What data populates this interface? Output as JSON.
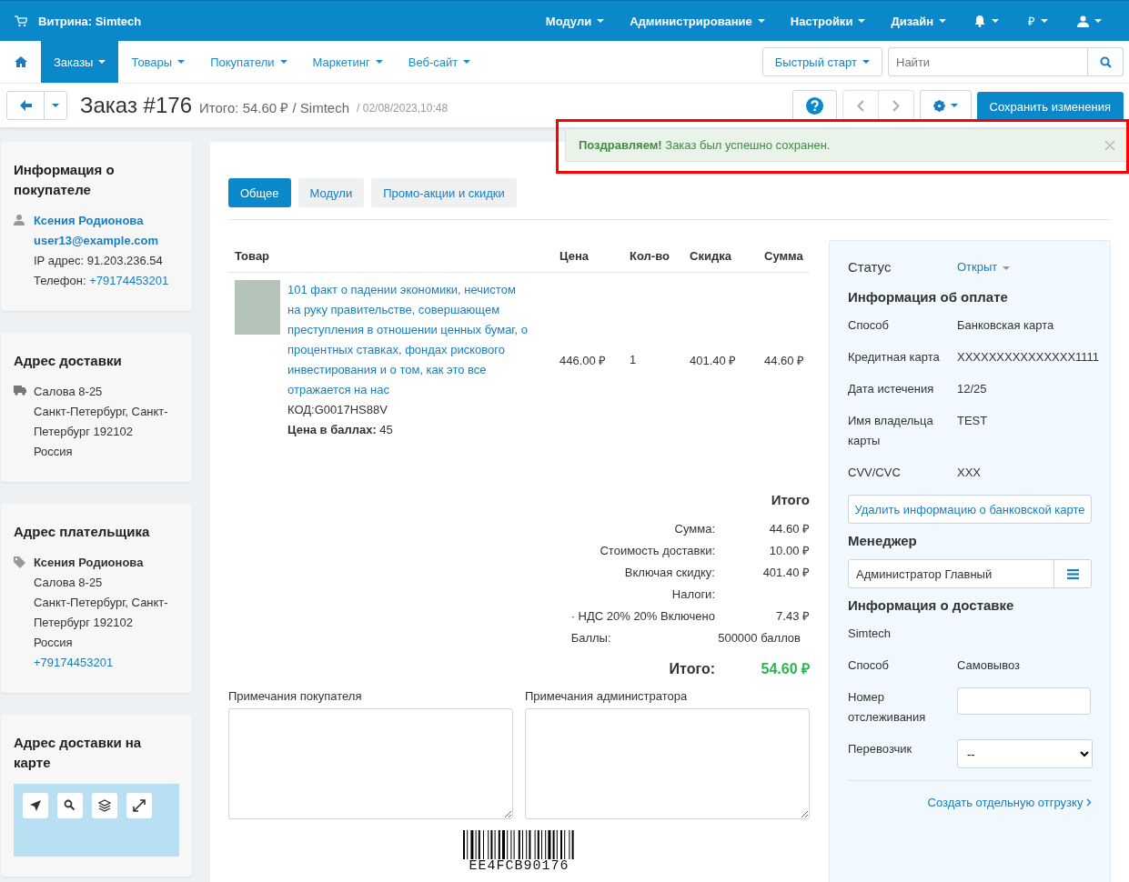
{
  "top_bar": {
    "store": "Витрина: Simtech",
    "menus": [
      "Модули",
      "Администрирование",
      "Настройки",
      "Дизайн"
    ],
    "currency": "₽"
  },
  "nav": {
    "items": [
      {
        "label": "Заказы",
        "selected": true
      },
      {
        "label": "Товары",
        "selected": false
      },
      {
        "label": "Покупатели",
        "selected": false
      },
      {
        "label": "Маркетинг",
        "selected": false
      },
      {
        "label": "Веб-сайт",
        "selected": false
      }
    ],
    "quick_start": "Быстрый старт",
    "search": {
      "placeholder": "Найти"
    }
  },
  "header": {
    "title": "Заказ #176",
    "summary": "Итого: 54.60 ₽ / Simtech",
    "date": "/ 02/08/2023,10:48",
    "save_button": "Сохранить изменения"
  },
  "notification": {
    "message": "**Поздравляем!** Заказ был успешно сохранен.",
    "highlighted": true
  },
  "customer": {
    "title": "Информация о покупателе",
    "name": "Ксения Родионова",
    "email": "user13@example.com",
    "ip": "IP адрес: 91.203.236.54",
    "phone_label": "Телефон:",
    "phone": "+79174453201"
  },
  "shipping_address": {
    "title": "Адрес доставки",
    "lines": [
      "Салова 8-25",
      "Санкт-Петербург, Санкт-Петербург 192102",
      "Россия"
    ]
  },
  "billing_address": {
    "title": "Адрес плательщика",
    "name": "Ксения Родионова",
    "lines": [
      "Салова 8-25",
      "Санкт-Петербург, Санкт-Петербург 192102",
      "Россия"
    ],
    "phone": "+79174453201"
  },
  "map": {
    "title": "Адрес доставки на карте"
  },
  "tabs": [
    {
      "label": "Общее",
      "selected": true
    },
    {
      "label": "Модули",
      "selected": false
    },
    {
      "label": "Промо-акции и скидки",
      "selected": false
    }
  ],
  "table": {
    "columns": [
      "Товар",
      "Цена",
      "Кол-во",
      "Скидка",
      "Сумма"
    ],
    "rows": [
      {
        "name": "101 факт о падении экономики, нечистом на руку правительстве, совершающем преступления в отношении ценных бумаг, о процентных ставках, фондах рискового инвестирования и о том, как это все отражается на нас",
        "code": "КОД:G0017HS88V",
        "points": "**Цена в баллах:** 45",
        "price": "446.00 ₽",
        "qty": "1",
        "discount": "401.40 ₽",
        "sum": "44.60 ₽"
      }
    ]
  },
  "totals": {
    "title": "Итого",
    "rows": [
      {
        "kind": "amount",
        "label": "Сумма:",
        "value": "44.60 ₽"
      },
      {
        "kind": "amount",
        "label": "Стоимость доставки:",
        "value": "10.00 ₽"
      },
      {
        "kind": "amount",
        "label": "Включая скидку:",
        "value": "401.40 ₽"
      },
      {
        "kind": "amount",
        "label": "Налоги:"
      },
      {
        "kind": "amount",
        "label": "· НДС 20% 20% Включено",
        "value": "7.43 ₽"
      },
      {
        "kind": "points",
        "label": "Баллы:",
        "value": "500000 баллов"
      },
      {
        "kind": "grand",
        "label": "Итого:",
        "value": "54.60 ₽"
      }
    ]
  },
  "notes": [
    "Примечания покупателя",
    "Примечания администратора"
  ],
  "barcode": "EE4FCB90176",
  "sidebar": {
    "status": {
      "label": "Статус",
      "value": "Открыт"
    },
    "payment": {
      "title": "Информация об оплате",
      "rows": [
        {
          "label": "Способ",
          "value": "Банковская карта"
        },
        {
          "label": "Кредитная карта",
          "value": "XXXXXXXXXXXXXXX1111"
        },
        {
          "label": "Дата истечения",
          "value": "12/25"
        },
        {
          "label": "Имя владельца карты",
          "value": "TEST"
        },
        {
          "label": "CVV/CVC",
          "value": "XXX"
        }
      ],
      "delete_button": "Удалить информацию о банковской карте"
    },
    "manager": {
      "title": "Менеджер",
      "value": "Администратор Главный"
    },
    "shipping": {
      "title": "Информация о доставке",
      "company": "Simtech",
      "method_label": "Способ",
      "method": "Самовывоз",
      "tracking_label": "Номер отслеживания",
      "carrier_label": "Перевозчик",
      "carrier": "--"
    },
    "split_link": "Создать отдельную отгрузку"
  }
}
